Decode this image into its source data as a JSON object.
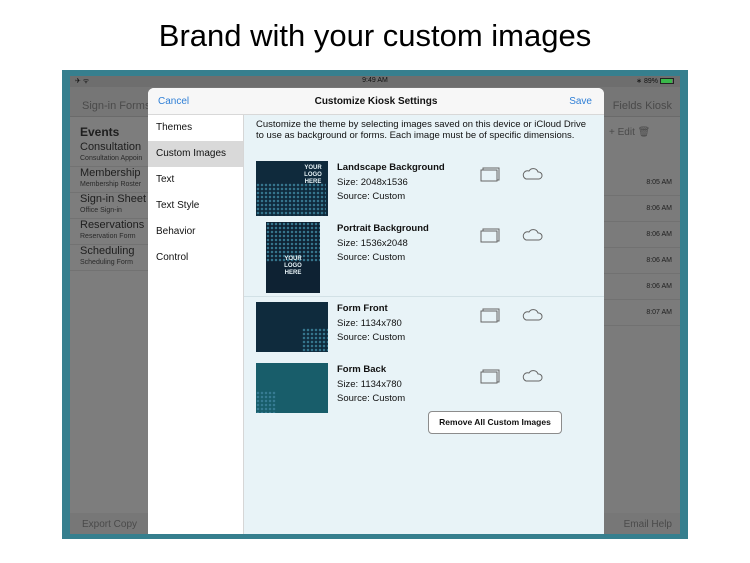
{
  "headline": "Brand with your custom images",
  "status_bar": {
    "time": "9:49 AM",
    "battery": "89%"
  },
  "background_app": {
    "nav_left": "Sign-in Forms",
    "nav_right": "Fields  Kiosk",
    "list_header": "Events",
    "list_items": [
      {
        "title": "Consultation",
        "subtitle": "Consultation Appoin"
      },
      {
        "title": "Membership",
        "subtitle": "Membership Roster"
      },
      {
        "title": "Sign-in Sheet",
        "subtitle": "Office Sign-in"
      },
      {
        "title": "Reservations",
        "subtitle": "Reservation Form"
      },
      {
        "title": "Scheduling",
        "subtitle": "Scheduling Form"
      }
    ],
    "toolbar": "+ Edit",
    "times": [
      "8:05 AM",
      "8:06 AM",
      "8:06 AM",
      "8:06 AM",
      "8:06 AM",
      "8:07 AM"
    ],
    "bottom_left": "Export  Copy",
    "bottom_right": "Email  Help"
  },
  "modal": {
    "cancel_label": "Cancel",
    "title": "Customize Kiosk Settings",
    "save_label": "Save",
    "sidebar": [
      "Themes",
      "Custom Images",
      "Text",
      "Text Style",
      "Behavior",
      "Control"
    ],
    "description": "Customize the theme by selecting images saved on this device or iCloud Drive to use as background or forms.  Each image must be of specific dimensions.",
    "images": [
      {
        "name": "Landscape Background",
        "size": "Size: 2048x1536",
        "source": "Source: Custom",
        "logo": "YOUR LOGO HERE"
      },
      {
        "name": "Portrait Background",
        "size": "Size: 1536x2048",
        "source": "Source: Custom",
        "logo": "YOUR LOGO HERE"
      },
      {
        "name": "Form Front",
        "size": "Size: 1134x780",
        "source": "Source: Custom"
      },
      {
        "name": "Form Back",
        "size": "Size: 1134x780",
        "source": "Source: Custom"
      }
    ],
    "remove_label": "Remove All Custom Images"
  },
  "colors": {
    "accent": "#2f7fd6",
    "frame": "#367f8e",
    "panel": "#e8f3f7"
  }
}
